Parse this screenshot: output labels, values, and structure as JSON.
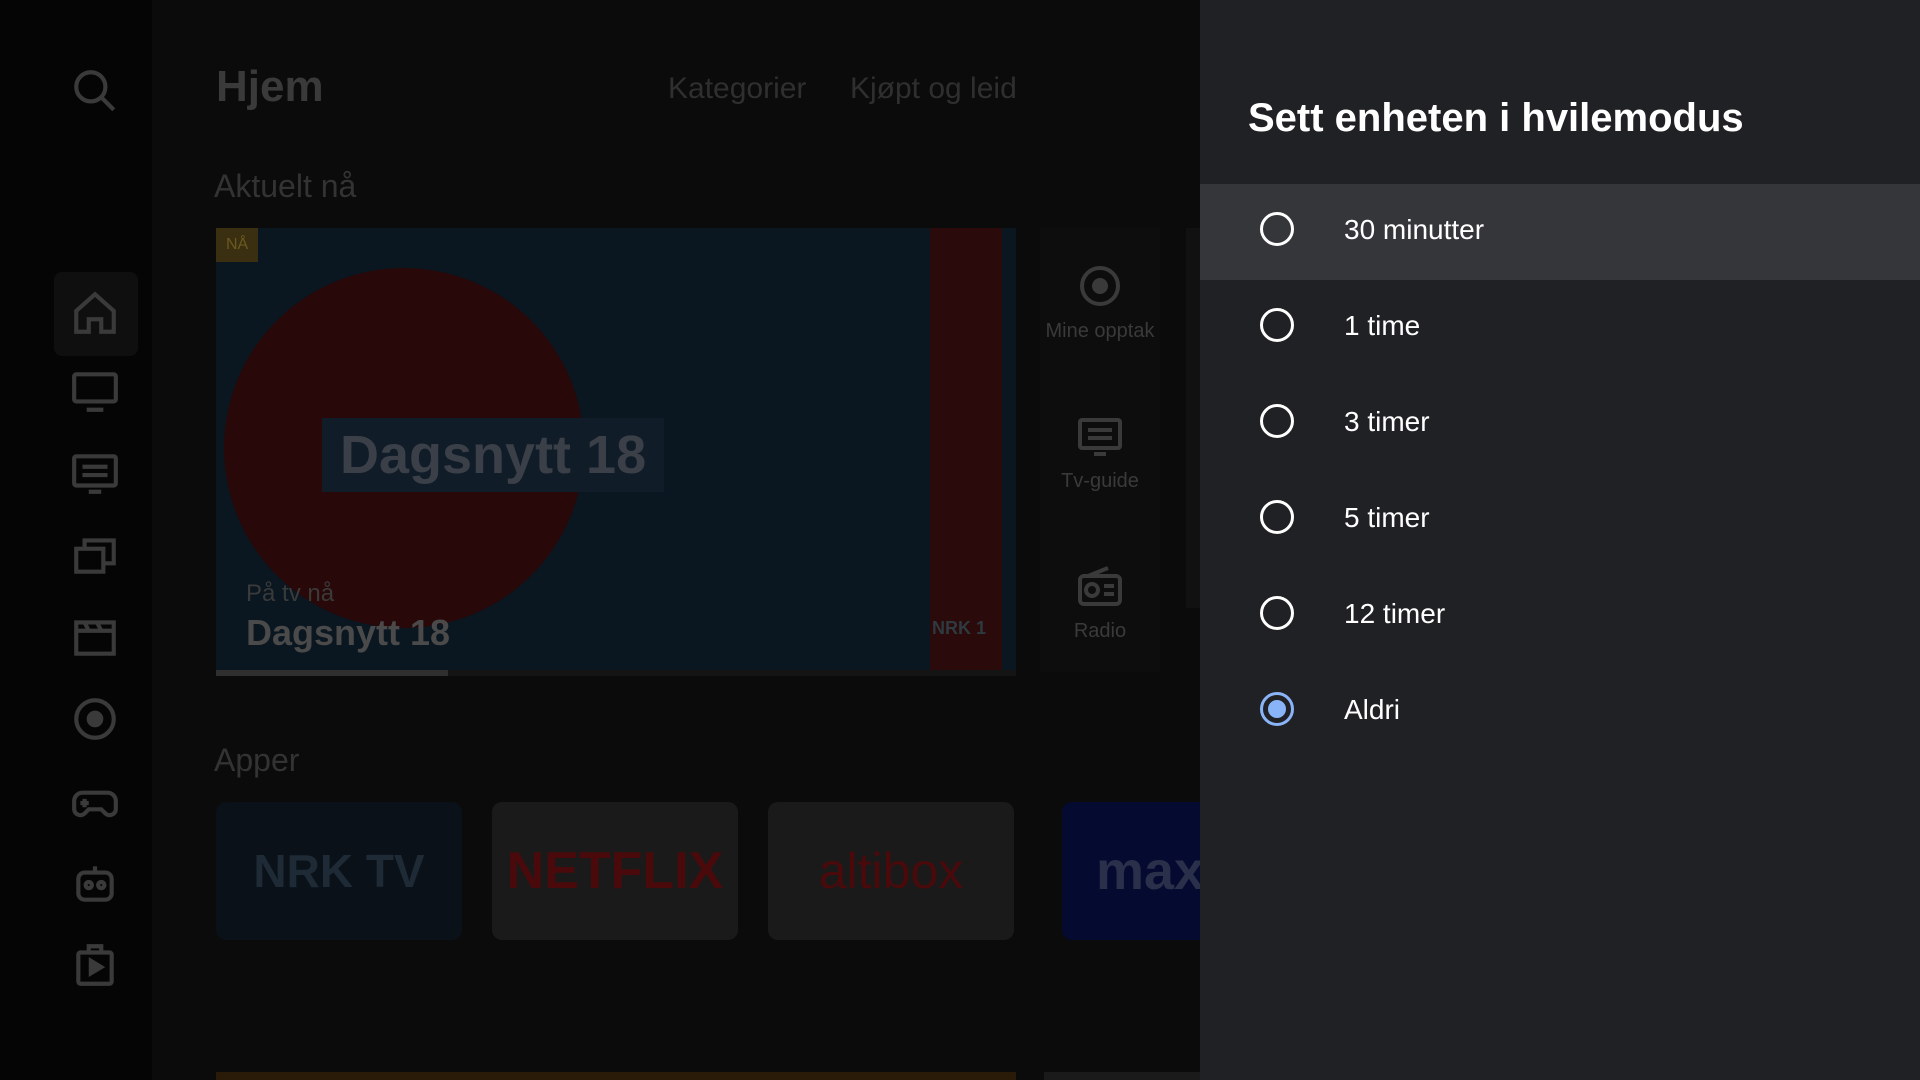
{
  "background": {
    "header": {
      "title": "Hjem",
      "nav": [
        "Kategorier",
        "Kjøpt og leid"
      ]
    },
    "current_section": {
      "title": "Aktuelt nå",
      "hero": {
        "badge": "NÅ",
        "logo_text": "Dagsnytt 18",
        "caption": "På tv nå",
        "program": "Dagsnytt 18",
        "channel": "NRK 1",
        "progress": 0.29
      },
      "side_cards": [
        {
          "icon": "record-icon",
          "label": "Mine opptak"
        },
        {
          "icon": "tv-guide-icon",
          "label": "Tv-guide"
        },
        {
          "icon": "radio-icon",
          "label": "Radio"
        }
      ]
    },
    "apps_section": {
      "title": "Apper",
      "apps": [
        {
          "name": "NRK TV",
          "color": "#0d1a26"
        },
        {
          "name": "NETFLIX",
          "color": "#e50914"
        },
        {
          "name": "altibox",
          "color": "#e30613"
        },
        {
          "name": "max",
          "color": "#002be7"
        }
      ]
    },
    "rail_icons": [
      "search-icon",
      "home-icon",
      "tv-icon",
      "tv-guide-icon",
      "library-icon",
      "movie-icon",
      "record-icon",
      "gamepad-icon",
      "kids-icon",
      "play-store-icon"
    ]
  },
  "panel": {
    "title": "Sett enheten i hvilemodus",
    "options": [
      {
        "label": "30 minutter",
        "selected": false,
        "focused": true
      },
      {
        "label": "1 time",
        "selected": false,
        "focused": false
      },
      {
        "label": "3 timer",
        "selected": false,
        "focused": false
      },
      {
        "label": "5 timer",
        "selected": false,
        "focused": false
      },
      {
        "label": "12 timer",
        "selected": false,
        "focused": false
      },
      {
        "label": "Aldri",
        "selected": true,
        "focused": false
      }
    ],
    "accent_color": "#8ab4f8"
  }
}
